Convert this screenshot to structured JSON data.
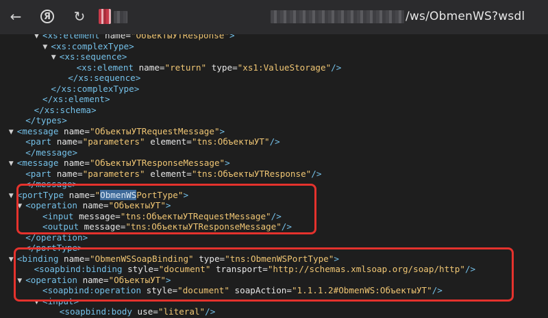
{
  "browser": {
    "back_icon": "←",
    "yandex_letter": "Я",
    "reload_icon": "↻",
    "url_path": "/ws/ObmenWS?wsdl"
  },
  "xml": {
    "lines": [
      {
        "indent": 5,
        "tri": "▼",
        "t": "<",
        "tag": "xs:element",
        "attrs": [
          {
            "n": "name",
            "v": "ОбъектыУТResponse"
          }
        ],
        "end": ">"
      },
      {
        "indent": 6,
        "tri": "▼",
        "t": "<",
        "tag": "xs:complexType",
        "attrs": [],
        "end": ">"
      },
      {
        "indent": 7,
        "tri": "▼",
        "t": "<",
        "tag": "xs:sequence",
        "attrs": [],
        "end": ">"
      },
      {
        "indent": 9,
        "tri": "",
        "t": "<",
        "tag": "xs:element",
        "attrs": [
          {
            "n": "name",
            "v": "return"
          },
          {
            "n": "type",
            "v": "xs1:ValueStorage"
          }
        ],
        "end": "/>"
      },
      {
        "indent": 8,
        "tri": "",
        "t": "</",
        "tag": "xs:sequence",
        "attrs": [],
        "end": ">"
      },
      {
        "indent": 6,
        "tri": "",
        "t": "</",
        "tag": "xs:complexType",
        "attrs": [],
        "end": ">"
      },
      {
        "indent": 5,
        "tri": "",
        "t": "</",
        "tag": "xs:element",
        "attrs": [],
        "end": ">"
      },
      {
        "indent": 4,
        "tri": "",
        "t": "</",
        "tag": "xs:schema",
        "attrs": [],
        "end": ">"
      },
      {
        "indent": 3,
        "tri": "",
        "t": "</",
        "tag": "types",
        "attrs": [],
        "end": ">"
      },
      {
        "indent": 2,
        "tri": "▼",
        "t": "<",
        "tag": "message",
        "attrs": [
          {
            "n": "name",
            "v": "ОбъектыУТRequestMessage"
          }
        ],
        "end": ">"
      },
      {
        "indent": 3,
        "tri": "",
        "t": "<",
        "tag": "part",
        "attrs": [
          {
            "n": "name",
            "v": "parameters"
          },
          {
            "n": "element",
            "v": "tns:ОбъектыУТ"
          }
        ],
        "end": "/>"
      },
      {
        "indent": 3,
        "tri": "",
        "t": "</",
        "tag": "message",
        "attrs": [],
        "end": ">"
      },
      {
        "indent": 2,
        "tri": "▼",
        "t": "<",
        "tag": "message",
        "attrs": [
          {
            "n": "name",
            "v": "ОбъектыУТResponseMessage"
          }
        ],
        "end": ">"
      },
      {
        "indent": 3,
        "tri": "",
        "t": "<",
        "tag": "part",
        "attrs": [
          {
            "n": "name",
            "v": "parameters"
          },
          {
            "n": "element",
            "v": "tns:ОбъектыУТResponse"
          }
        ],
        "end": "/>"
      },
      {
        "indent": 3,
        "tri": "",
        "t": "</",
        "tag": "message",
        "attrs": [],
        "end": ">"
      },
      {
        "indent": 2,
        "tri": "▼",
        "t": "<",
        "tag": "portType",
        "attrs": [
          {
            "n": "name",
            "v": "ObmenWSPortType",
            "hl": "ObmenWS"
          }
        ],
        "end": ">"
      },
      {
        "indent": 3,
        "tri": "▼",
        "t": "<",
        "tag": "operation",
        "attrs": [
          {
            "n": "name",
            "v": "ОбъектыУТ"
          }
        ],
        "end": ">"
      },
      {
        "indent": 5,
        "tri": "",
        "t": "<",
        "tag": "input",
        "attrs": [
          {
            "n": "message",
            "v": "tns:ОбъектыУТRequestMessage"
          }
        ],
        "end": "/>"
      },
      {
        "indent": 5,
        "tri": "",
        "t": "<",
        "tag": "output",
        "attrs": [
          {
            "n": "message",
            "v": "tns:ОбъектыУТResponseMessage"
          }
        ],
        "end": "/>"
      },
      {
        "indent": 3,
        "tri": "",
        "t": "</",
        "tag": "operation",
        "attrs": [],
        "end": ">"
      },
      {
        "indent": 3,
        "tri": "",
        "t": "</",
        "tag": "portType",
        "attrs": [],
        "end": ">"
      },
      {
        "indent": 2,
        "tri": "▼",
        "t": "<",
        "tag": "binding",
        "attrs": [
          {
            "n": "name",
            "v": "ObmenWSSoapBinding"
          },
          {
            "n": "type",
            "v": "tns:ObmenWSPortType"
          }
        ],
        "end": ">"
      },
      {
        "indent": 4,
        "tri": "",
        "t": "<",
        "tag": "soapbind:binding",
        "attrs": [
          {
            "n": "style",
            "v": "document"
          },
          {
            "n": "transport",
            "v": "http://schemas.xmlsoap.org/soap/http"
          }
        ],
        "end": "/>"
      },
      {
        "indent": 3,
        "tri": "▼",
        "t": "<",
        "tag": "operation",
        "attrs": [
          {
            "n": "name",
            "v": "ОбъектыУТ"
          }
        ],
        "end": ">"
      },
      {
        "indent": 5,
        "tri": "",
        "t": "<",
        "tag": "soapbind:operation",
        "attrs": [
          {
            "n": "style",
            "v": "document"
          },
          {
            "n": "soapAction",
            "v": "1.1.1.2#ObmenWS:ОбъектыУТ"
          }
        ],
        "end": "/>"
      },
      {
        "indent": 5,
        "tri": "▼",
        "t": "<",
        "tag": "input",
        "attrs": [],
        "end": ">"
      },
      {
        "indent": 7,
        "tri": "",
        "t": "<",
        "tag": "soapbind:body",
        "attrs": [
          {
            "n": "use",
            "v": "literal"
          }
        ],
        "end": "/>"
      }
    ]
  }
}
